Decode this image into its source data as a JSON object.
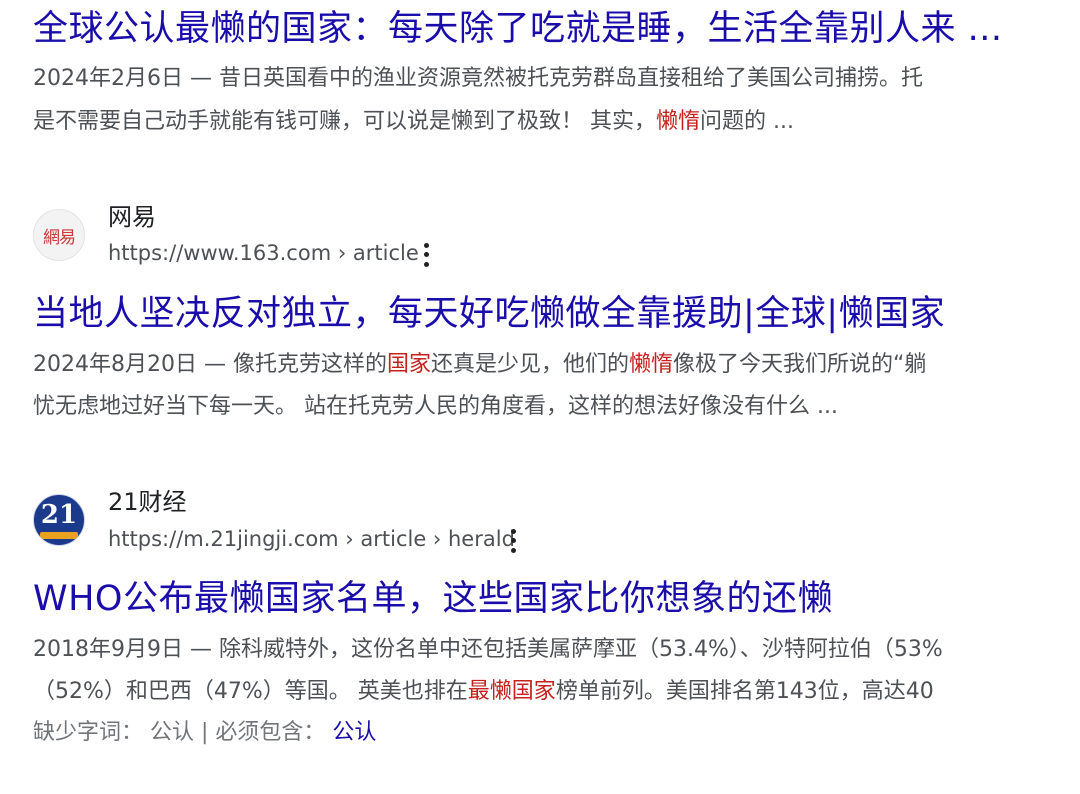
{
  "results": [
    {
      "title": "全球公认最懒的国家：每天除了吃就是睡，生活全靠别人来 ...",
      "snippet_line1": "2024年2月6日 — 昔日英国看中的渔业资源竟然被托克劳群岛直接租给了美国公司捕捞。托",
      "snippet_line2_a": "是不需要自己动手就能有钱可赚，可以说是懒到了极致！ 其实，",
      "snippet_line2_em": "懒惰",
      "snippet_line2_b": "问题的 ..."
    },
    {
      "site_name": "网易",
      "favicon_text": "網易",
      "url": "https://www.163.com › article",
      "title": "当地人坚决反对独立，每天好吃懒做全靠援助|全球|懒国家",
      "snippet_line1_a": "2024年8月20日 — 像托克劳这样的",
      "snippet_line1_em1": "国家",
      "snippet_line1_b": "还真是少见，他们的",
      "snippet_line1_em2": "懒惰",
      "snippet_line1_c": "像极了今天我们所说的“躺",
      "snippet_line2": "忧无虑地过好当下每一天。 站在托克劳人民的角度看，这样的想法好像没有什么 ..."
    },
    {
      "site_name": "21财经",
      "favicon_text": "21",
      "url": "https://m.21jingji.com › article › herald",
      "title": "WHO公布最懒国家名单，这些国家比你想象的还懒",
      "snippet_line1": "2018年9月9日 — 除科威特外，这份名单中还包括美属萨摩亚（53.4%）、沙特阿拉伯（53%",
      "snippet_line2_a": "（52%）和巴西（47%）等国。 英美也排在",
      "snippet_line2_em": "最懒国家",
      "snippet_line2_b": "榜单前列。美国排名第143位，高达40",
      "missing_label": "缺少字词： 公认 | 必须包含：",
      "missing_link": "公认"
    }
  ],
  "icons": {
    "more": "more-vert-icon"
  },
  "colors": {
    "title_link": "#1a0dab",
    "snippet_text": "#4d5156",
    "emphasis": "#c5221f"
  }
}
